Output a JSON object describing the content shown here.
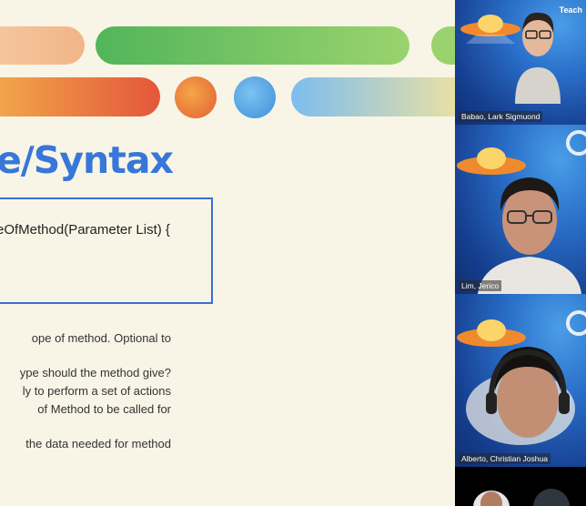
{
  "slide": {
    "title": "e/Syntax",
    "code": "eOfMethod(Parameter List) {",
    "bullets": [
      "ope of method. Optional to",
      "ype should the method give?",
      "ly to perform a set of actions",
      "of Method to be called for",
      "the data needed for method"
    ]
  },
  "participants": [
    {
      "name": "Babao, Lark Sigmuond"
    },
    {
      "name": "Lim, Jerico"
    },
    {
      "name": "Alberto, Christian Joshua"
    }
  ],
  "brand": "Teach",
  "colors": {
    "title": "#3877d9",
    "code_border": "#3a6fd4",
    "slide_bg": "#f8f5e6",
    "tile_bg": "#2a6fc9"
  }
}
